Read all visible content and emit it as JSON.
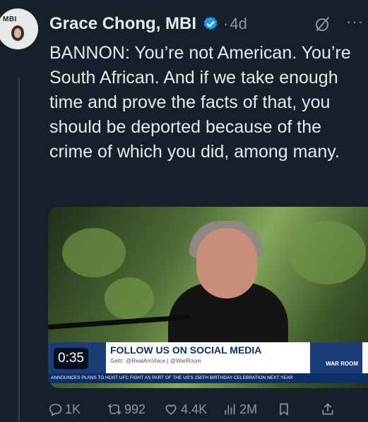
{
  "author": {
    "avatar_tag": "MBI",
    "name": "Grace Chong, MBI",
    "separator": "·",
    "time": "4d"
  },
  "tweet": {
    "text": "BANNON: You’re not American. You’re South African. And if we take enough time and prove the facts of that, you should be deported because of the crime of which you did, among many."
  },
  "media": {
    "duration": "0:35",
    "lower_third_title": "FOLLOW US ON SOCIAL MEDIA",
    "lower_third_sub": "Gettr: @RealAmVoice | @WarRoom",
    "logo_text": "WAR ROOM",
    "ticker": "ANNOUNCES PLANS TO HOST UFC FIGHT AS PART OF THE US'S 250TH BIRTHDAY CELEBRATION NEXT YEAR"
  },
  "actions": {
    "replies": "1K",
    "reposts": "992",
    "likes": "4.4K",
    "views": "2M"
  },
  "colors": {
    "background": "#15202b",
    "text": "#e7e9ea",
    "muted": "#8b98a5",
    "verified": "#1d9bf0"
  },
  "icons": [
    "verified-badge-icon",
    "grok-icon",
    "more-icon",
    "reply-icon",
    "repost-icon",
    "like-icon",
    "views-icon",
    "bookmark-icon",
    "share-icon"
  ]
}
